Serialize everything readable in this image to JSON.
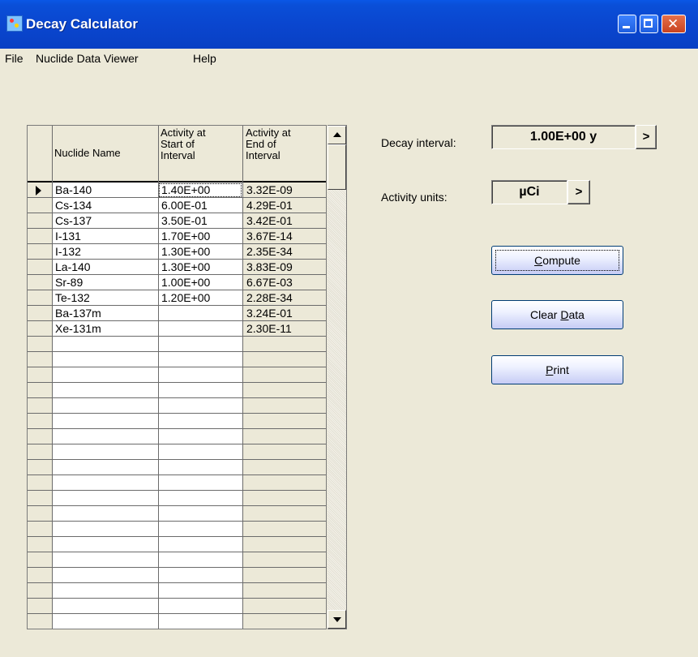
{
  "window": {
    "title": "Decay Calculator"
  },
  "menu": {
    "items": [
      "File",
      "Nuclide Data Viewer",
      "Help"
    ]
  },
  "table": {
    "headers": {
      "name": "Nuclide Name",
      "start": [
        "Activity at",
        "Start of",
        "Interval"
      ],
      "end": [
        "Activity at",
        "End of",
        "Interval"
      ]
    },
    "rows": [
      {
        "name": "Ba-140",
        "start": "1.40E+00",
        "end": "3.32E-09"
      },
      {
        "name": "Cs-134",
        "start": "6.00E-01",
        "end": "4.29E-01"
      },
      {
        "name": "Cs-137",
        "start": "3.50E-01",
        "end": "3.42E-01"
      },
      {
        "name": "I-131",
        "start": "1.70E+00",
        "end": "3.67E-14"
      },
      {
        "name": "I-132",
        "start": "1.30E+00",
        "end": "2.35E-34"
      },
      {
        "name": "La-140",
        "start": "1.30E+00",
        "end": "3.83E-09"
      },
      {
        "name": "Sr-89",
        "start": "1.00E+00",
        "end": "6.67E-03"
      },
      {
        "name": "Te-132",
        "start": "1.20E+00",
        "end": "2.28E-34"
      },
      {
        "name": "Ba-137m",
        "start": "",
        "end": "3.24E-01"
      },
      {
        "name": "Xe-131m",
        "start": "",
        "end": "2.30E-11"
      }
    ],
    "current_row_index": 0
  },
  "decay_interval": {
    "label": "Decay interval:",
    "value": "1.00E+00 y",
    "button": ">"
  },
  "activity_units": {
    "label": "Activity units:",
    "value": "µCi",
    "button": ">"
  },
  "buttons": {
    "compute": {
      "label": "Compute",
      "mnemonic": "C",
      "rest": "ompute"
    },
    "clear": {
      "label": "Clear Data",
      "pre": "Clear ",
      "mnemonic": "D",
      "rest": "ata"
    },
    "print": {
      "label": "Print",
      "mnemonic": "P",
      "rest": "rint"
    }
  }
}
